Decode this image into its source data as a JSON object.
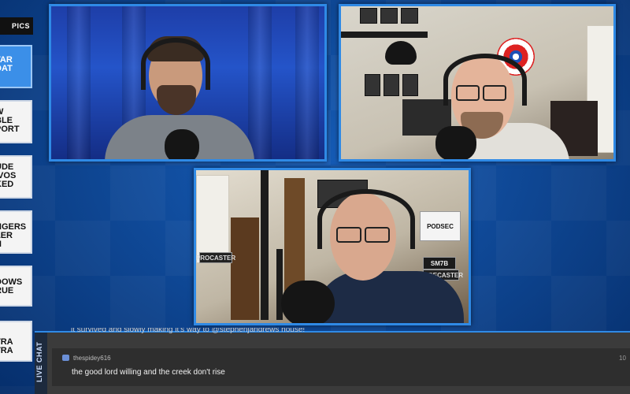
{
  "topics_header": "PICS",
  "topics": [
    {
      "id": "star",
      "lines": [
        "TAR",
        "DAT"
      ],
      "active": true
    },
    {
      "id": "portable",
      "lines": [
        "W",
        "BLE",
        "PORT"
      ],
      "active": false
    },
    {
      "id": "feude",
      "lines": [
        "UDE",
        "IVOS",
        "KED"
      ],
      "active": false
    },
    {
      "id": "avengers",
      "lines": [
        "NGERS",
        "LER",
        "N"
      ],
      "active": false
    },
    {
      "id": "shadows",
      "lines": [
        "DOWS",
        "RUE"
      ],
      "active": false
    },
    {
      "id": "extra",
      "lines": [
        "TRA",
        "TRA"
      ],
      "active": false
    }
  ],
  "chat": {
    "tab_label": "LIVE CHAT",
    "previous_message": "it survived and slowly making it's way to @stephenjandrews house!",
    "message": {
      "username": "thespidey616",
      "text": "the good lord willing and the creek don't rise",
      "time": "10"
    }
  },
  "studio_signs": {
    "podcaster_left": "PROCASTER",
    "podsec": "PODSEC",
    "sm7b": "SM7B",
    "rodecaster": "RODECASTER"
  }
}
